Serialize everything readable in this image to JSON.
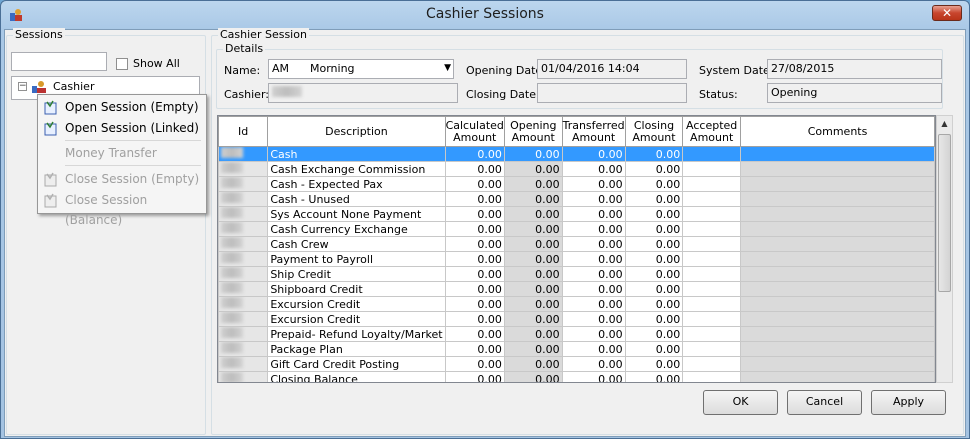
{
  "window": {
    "title": "Cashier Sessions",
    "close_label": "✕"
  },
  "sessions": {
    "group_title": "Sessions",
    "show_all_label": "Show All",
    "show_all_checked": false,
    "tree_root": "Cashier"
  },
  "context_menu": {
    "items": [
      {
        "label": "Open Session (Empty)",
        "enabled": true
      },
      {
        "label": "Open Session (Linked)",
        "enabled": true
      },
      {
        "label": "Money Transfer",
        "enabled": false
      },
      {
        "label": "Close Session (Empty)",
        "enabled": false
      },
      {
        "label": "Close Session (Balance)",
        "enabled": false
      }
    ]
  },
  "cashier_session": {
    "group_title": "Cashier Session",
    "details_title": "Details",
    "name_label": "Name:",
    "name_value": "AM      Morning",
    "cashier_label": "Cashier:",
    "opening_date_label": "Opening Date:",
    "opening_date_value": "01/04/2016 14:04",
    "closing_date_label": "Closing Date:",
    "closing_date_value": "",
    "system_date_label": "System Date:",
    "system_date_value": "27/08/2015",
    "status_label": "Status:",
    "status_value": "Opening"
  },
  "grid": {
    "headers": [
      "Id",
      "Description",
      "Calculated Amount",
      "Opening Amount",
      "Transferred Amount",
      "Closing Amount",
      "Accepted Amount",
      "Comments"
    ],
    "rows": [
      {
        "description": "Cash",
        "calculated": "0.00",
        "opening": "0.00",
        "transferred": "0.00",
        "closing": "0.00"
      },
      {
        "description": "Cash Exchange Commission",
        "calculated": "0.00",
        "opening": "0.00",
        "transferred": "0.00",
        "closing": "0.00"
      },
      {
        "description": "Cash - Expected Pax",
        "calculated": "0.00",
        "opening": "0.00",
        "transferred": "0.00",
        "closing": "0.00"
      },
      {
        "description": "Cash - Unused",
        "calculated": "0.00",
        "opening": "0.00",
        "transferred": "0.00",
        "closing": "0.00"
      },
      {
        "description": "Sys Account None Payment",
        "calculated": "0.00",
        "opening": "0.00",
        "transferred": "0.00",
        "closing": "0.00"
      },
      {
        "description": "Cash Currency Exchange",
        "calculated": "0.00",
        "opening": "0.00",
        "transferred": "0.00",
        "closing": "0.00"
      },
      {
        "description": "Cash Crew",
        "calculated": "0.00",
        "opening": "0.00",
        "transferred": "0.00",
        "closing": "0.00"
      },
      {
        "description": "Payment to Payroll",
        "calculated": "0.00",
        "opening": "0.00",
        "transferred": "0.00",
        "closing": "0.00"
      },
      {
        "description": "Ship Credit",
        "calculated": "0.00",
        "opening": "0.00",
        "transferred": "0.00",
        "closing": "0.00"
      },
      {
        "description": "Shipboard Credit",
        "calculated": "0.00",
        "opening": "0.00",
        "transferred": "0.00",
        "closing": "0.00"
      },
      {
        "description": "Excursion Credit",
        "calculated": "0.00",
        "opening": "0.00",
        "transferred": "0.00",
        "closing": "0.00"
      },
      {
        "description": "Excursion Credit",
        "calculated": "0.00",
        "opening": "0.00",
        "transferred": "0.00",
        "closing": "0.00"
      },
      {
        "description": "Prepaid- Refund Loyalty/Market",
        "calculated": "0.00",
        "opening": "0.00",
        "transferred": "0.00",
        "closing": "0.00"
      },
      {
        "description": "Package Plan",
        "calculated": "0.00",
        "opening": "0.00",
        "transferred": "0.00",
        "closing": "0.00"
      },
      {
        "description": "Gift Card Credit Posting",
        "calculated": "0.00",
        "opening": "0.00",
        "transferred": "0.00",
        "closing": "0.00"
      },
      {
        "description": "Closing Balance",
        "calculated": "0.00",
        "opening": "0.00",
        "transferred": "0.00",
        "closing": "0.00"
      }
    ]
  },
  "buttons": {
    "ok": "OK",
    "cancel": "Cancel",
    "apply": "Apply"
  },
  "colors": {
    "selection": "#3399ff",
    "title_bar": "#a9c8e6",
    "close": "#c8452d"
  },
  "icons": {
    "app": "cashier-app-icon",
    "tree": "cashier-icon",
    "menu": "session-icon"
  }
}
